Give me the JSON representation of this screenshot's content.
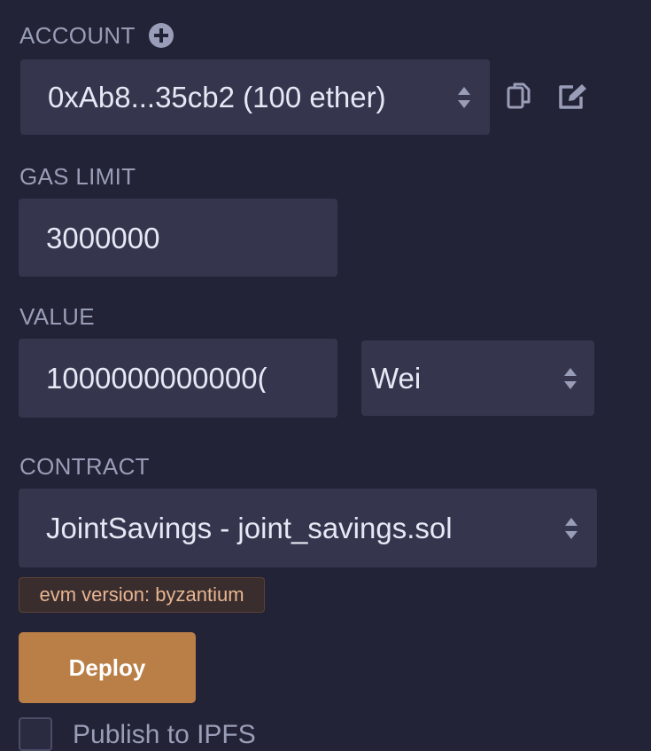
{
  "account": {
    "label": "ACCOUNT",
    "add_icon": "plus-circle-icon",
    "value": "0xAb8...35cb2 (100 ether)",
    "copy_icon": "copy-icon",
    "edit_icon": "edit-icon"
  },
  "gas_limit": {
    "label": "GAS LIMIT",
    "value": "3000000"
  },
  "value": {
    "label": "VALUE",
    "amount": "1000000000000(",
    "unit": "Wei"
  },
  "contract": {
    "label": "CONTRACT",
    "selected": "JointSavings - joint_savings.sol"
  },
  "evm_badge": "evm version: byzantium",
  "deploy_label": "Deploy",
  "publish_label": "Publish to IPFS",
  "colors": {
    "background": "#222336",
    "field": "#35364d",
    "deploy": "#b97f47",
    "badge_text": "#e7b590"
  }
}
